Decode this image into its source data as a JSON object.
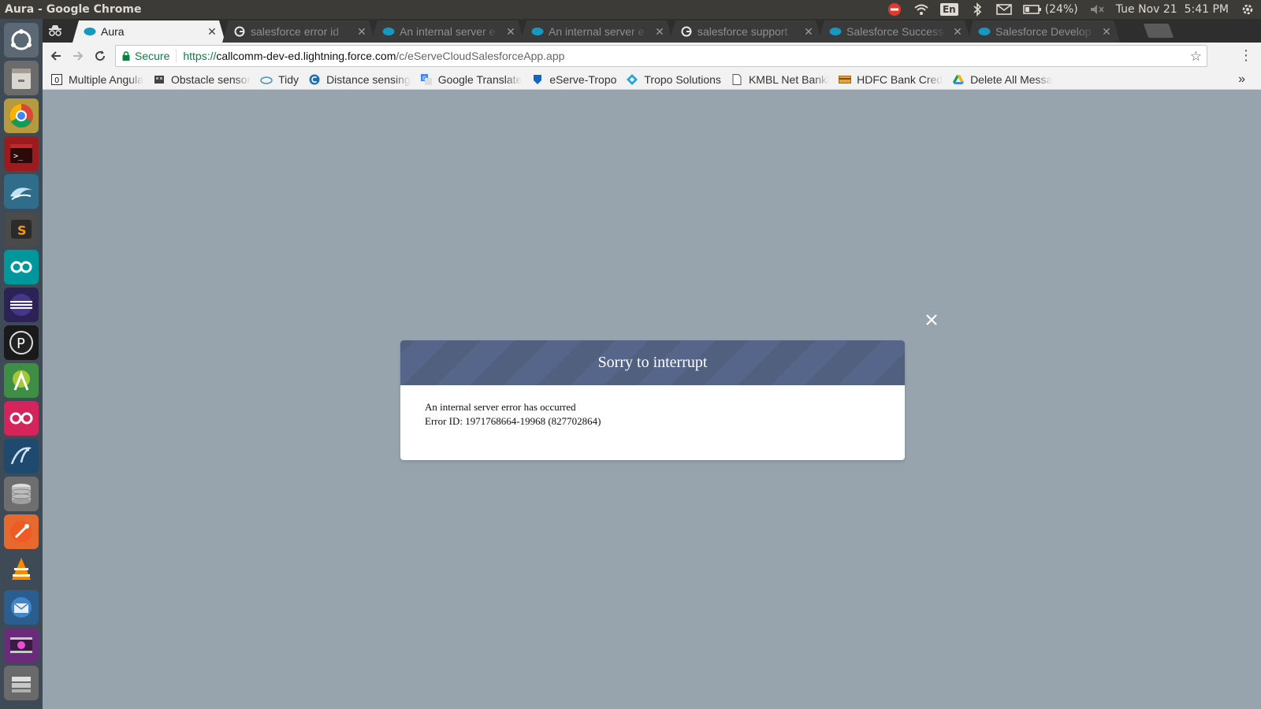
{
  "window": {
    "title": "Aura - Google Chrome"
  },
  "system_tray": {
    "language": "En",
    "battery": "(24%)",
    "datetime": "Tue Nov 21  5:41 PM"
  },
  "launcher": {
    "apps": [
      "dash-icon",
      "files-icon",
      "chrome-icon",
      "terminal-icon",
      "wireshark-icon",
      "sublime-icon",
      "arduino-icon",
      "eclipse-icon",
      "processing-icon",
      "android-studio-icon",
      "flickr-icon",
      "mysql-workbench-icon",
      "database-icon",
      "postman-icon",
      "vlc-icon",
      "thunderbird-icon",
      "video-icon",
      "storage-icon"
    ]
  },
  "tabs": [
    {
      "label": "Aura",
      "icon": "salesforce-cloud-icon",
      "active": true
    },
    {
      "label": "salesforce error id",
      "icon": "google-g-icon",
      "active": false
    },
    {
      "label": "An internal server e",
      "icon": "salesforce-cloud-icon",
      "active": false
    },
    {
      "label": "An internal server e",
      "icon": "salesforce-cloud-icon",
      "active": false
    },
    {
      "label": "salesforce support",
      "icon": "google-g-icon",
      "active": false
    },
    {
      "label": "Salesforce Success",
      "icon": "salesforce-cloud-icon",
      "active": false
    },
    {
      "label": "Salesforce Develop",
      "icon": "salesforce-cloud-icon",
      "active": false
    }
  ],
  "toolbar": {
    "secure_label": "Secure",
    "url_scheme": "https://",
    "url_host": "callcomm-dev-ed.lightning.force.com",
    "url_path": "/c/eServeCloudSalesforceApp.app"
  },
  "bookmarks": [
    {
      "label": "Multiple Angula",
      "icon": "page-0-icon"
    },
    {
      "label": "Obstacle sensor",
      "icon": "sensor-icon"
    },
    {
      "label": "Tidy",
      "icon": "tidy-cloud-icon"
    },
    {
      "label": "Distance sensing",
      "icon": "c-icon"
    },
    {
      "label": "Google Translate",
      "icon": "translate-icon"
    },
    {
      "label": "eServe-Tropo",
      "icon": "shield-icon"
    },
    {
      "label": "Tropo Solutions",
      "icon": "diamond-icon"
    },
    {
      "label": "KMBL Net Banki",
      "icon": "document-icon"
    },
    {
      "label": "HDFC Bank Cred",
      "icon": "card-icon"
    },
    {
      "label": "Delete All Messa",
      "icon": "drive-icon"
    }
  ],
  "modal": {
    "title": "Sorry to interrupt",
    "message": "An internal server error has occurred",
    "error_id": "Error ID: 1971768664-19968 (827702864)"
  }
}
